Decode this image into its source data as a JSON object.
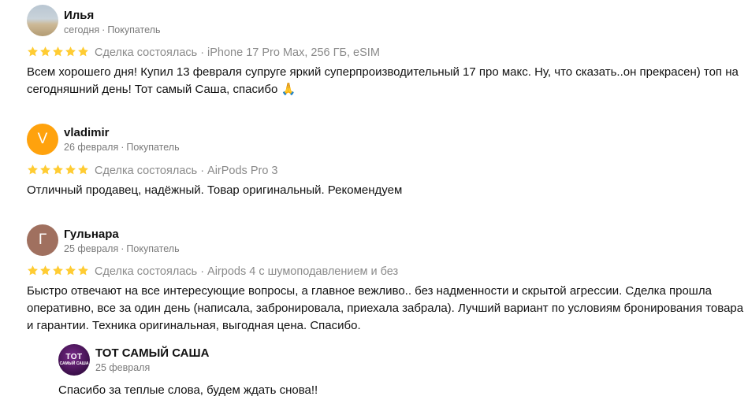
{
  "colors": {
    "star": "#ffcc33",
    "avatar_v": "#ffa20d",
    "avatar_g": "#a0705f"
  },
  "reviews": [
    {
      "name": "Илья",
      "date": "сегодня",
      "role": "Покупатель",
      "avatar_type": "photo",
      "stars": 5,
      "deal_status": "Сделка состоялась",
      "item": "iPhone 17 Pro Max, 256 ГБ, eSIM",
      "text": "Всем хорошего дня! Купил 13 февраля супруге яркий суперпроизводительный 17 про макс. Ну, что сказать..он прекрасен) топ на сегодняшний день! Тот самый Саша, спасибо 🙏"
    },
    {
      "name": "vladimir",
      "date": "26 февраля",
      "role": "Покупатель",
      "avatar_letter": "V",
      "stars": 5,
      "deal_status": "Сделка состоялась",
      "item": "AirPods Pro 3",
      "text": "Отличный продавец, надёжный. Товар оригинальный. Рекомендуем"
    },
    {
      "name": "Гульнара",
      "date": "25 февраля",
      "role": "Покупатель",
      "avatar_letter": "Г",
      "stars": 5,
      "deal_status": "Сделка состоялась",
      "item": "Airpods 4 с шумоподавлением и без",
      "text": "Быстро отвечают на все интересующие вопросы, а главное вежливо.. без надменности и скрытой агрессии. Сделка прошла оперативно, все за один день (написала, забронировала, приехала забрала). Лучший вариант по условиям бронирования товара и гарантии. Техника оригинальная, выгодная цена. Спасибо.",
      "reply": {
        "name": "ТОТ САМЫЙ САША",
        "date": "25 февраля",
        "logo_big": "ТОТ",
        "logo_small": "САМЫЙ САША",
        "text": "Спасибо за теплые слова, будем ждать снова!!"
      }
    }
  ]
}
